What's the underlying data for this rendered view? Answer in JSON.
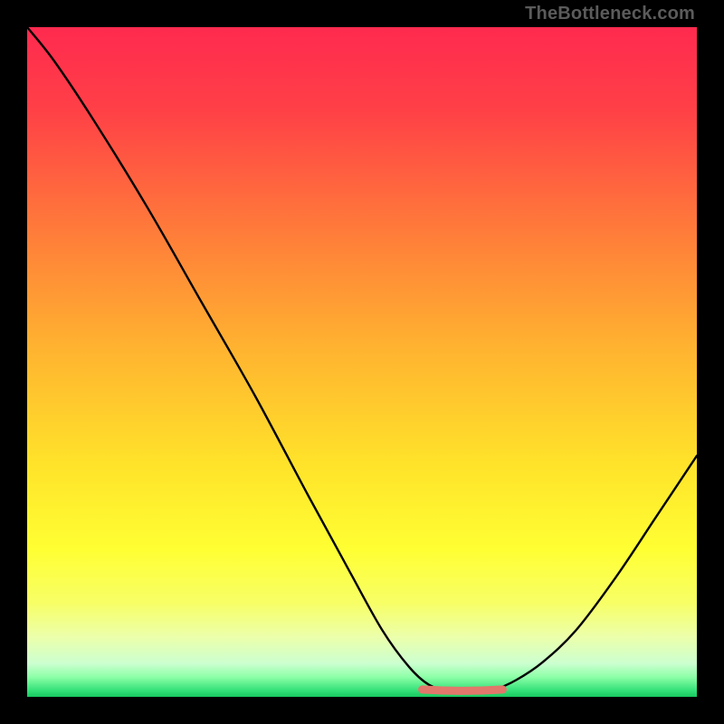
{
  "watermark": "TheBottleneck.com",
  "colors": {
    "frame": "#000000",
    "curve": "#000000",
    "optimal_marker": "#e2776b",
    "gradient_top": "#ff2a4f",
    "gradient_bottom": "#17c95f"
  },
  "chart_data": {
    "type": "line",
    "title": "",
    "xlabel": "",
    "ylabel": "",
    "xlim": [
      0,
      100
    ],
    "ylim": [
      0,
      100
    ],
    "curve": [
      {
        "x": 0,
        "y": 100
      },
      {
        "x": 4,
        "y": 95
      },
      {
        "x": 10,
        "y": 86
      },
      {
        "x": 18,
        "y": 73
      },
      {
        "x": 26,
        "y": 59
      },
      {
        "x": 34,
        "y": 45
      },
      {
        "x": 42,
        "y": 30
      },
      {
        "x": 48,
        "y": 19
      },
      {
        "x": 53,
        "y": 10
      },
      {
        "x": 57,
        "y": 4.5
      },
      {
        "x": 60,
        "y": 1.8
      },
      {
        "x": 63,
        "y": 0.9
      },
      {
        "x": 67,
        "y": 0.9
      },
      {
        "x": 70,
        "y": 1.2
      },
      {
        "x": 73,
        "y": 2.5
      },
      {
        "x": 77,
        "y": 5.2
      },
      {
        "x": 82,
        "y": 10
      },
      {
        "x": 88,
        "y": 18
      },
      {
        "x": 94,
        "y": 27
      },
      {
        "x": 100,
        "y": 36
      }
    ],
    "optimal_range": {
      "x_start": 59,
      "x_end": 71,
      "y": 1.1
    },
    "optimal_marker_width": 9,
    "description": "Bottleneck-style heat chart: vertical rainbow gradient (red at top = high bottleneck, green at bottom = balanced). Black V-shaped curve shows mismatch vs component ratio; short salmon segment at the trough marks the optimal pairing zone."
  }
}
